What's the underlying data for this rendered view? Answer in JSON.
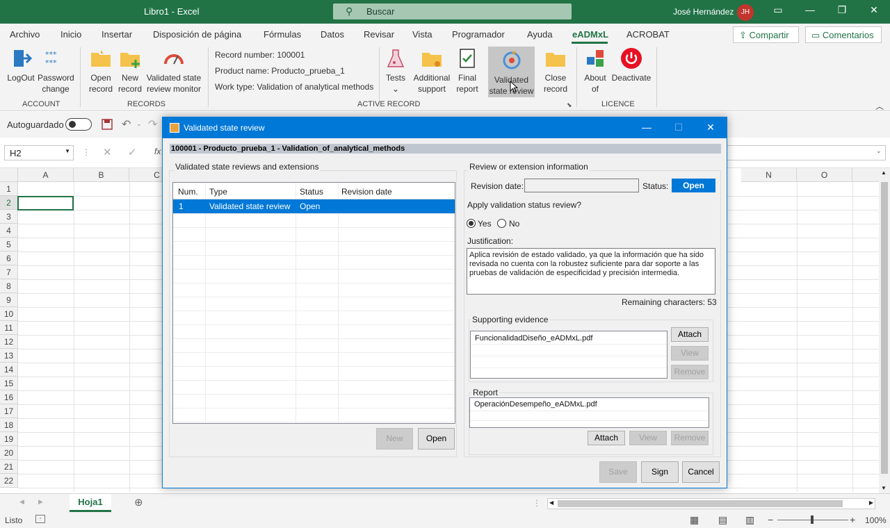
{
  "titlebar": {
    "doc_title": "Libro1  -  Excel",
    "search_placeholder": "Buscar",
    "user_name": "José Hernández",
    "user_initials": "JH"
  },
  "menu": {
    "items": [
      "Archivo",
      "Inicio",
      "Insertar",
      "Disposición de página",
      "Fórmulas",
      "Datos",
      "Revisar",
      "Vista",
      "Programador",
      "Ayuda",
      "eADMxL",
      "ACROBAT"
    ],
    "active": "eADMxL",
    "share": "Compartir",
    "comments": "Comentarios"
  },
  "ribbon": {
    "logout": "LogOut",
    "password1": "Password",
    "password2": "change",
    "open1": "Open",
    "open2": "record",
    "new1": "New",
    "new2": "record",
    "monitor1": "Validated state",
    "monitor2": "review monitor",
    "record_number": "Record number: 100001",
    "product_name": "Product name: Producto_prueba_1",
    "work_type": "Work type: Validation of analytical methods",
    "tests": "Tests",
    "additional1": "Additional",
    "additional2": "support",
    "final1": "Final",
    "final2": "report",
    "validated1": "Validated",
    "validated2": "state review",
    "close1": "Close",
    "close2": "record",
    "about1": "About",
    "about2": "of",
    "deactivate": "Deactivate",
    "groups": {
      "account": "ACCOUNT",
      "records": "RECORDS",
      "active_record": "ACTIVE RECORD",
      "licence": "LICENCE"
    }
  },
  "quick": {
    "autosave": "Autoguardado"
  },
  "formula": {
    "namebox": "H2",
    "fx": "fx"
  },
  "grid": {
    "columns": [
      "A",
      "B",
      "C",
      "N",
      "O"
    ],
    "rows": [
      "1",
      "2",
      "3",
      "4",
      "5",
      "6",
      "7",
      "8",
      "9",
      "10",
      "11",
      "12",
      "13",
      "14",
      "15",
      "16",
      "17",
      "18",
      "19",
      "20",
      "21",
      "22"
    ]
  },
  "sheet": {
    "tab": "Hoja1"
  },
  "status": {
    "ready": "Listo",
    "zoom": "100%"
  },
  "dialog": {
    "title": "Validated state review",
    "record_bar": "100001 - Producto_prueba_1 - Validation_of_analytical_methods",
    "left_group": "Validated state reviews and extensions",
    "table": {
      "headers": [
        "Num.",
        "Type",
        "Status",
        "Revision date"
      ],
      "rows": [
        {
          "num": "1",
          "type": "Validated state review",
          "status": "Open",
          "date": ""
        }
      ]
    },
    "new_btn": "New",
    "open_btn": "Open",
    "right_group": "Review or extension information",
    "revision_date_label": "Revision date:",
    "revision_date_value": "",
    "status_label": "Status:",
    "status_value": "Open",
    "apply_question": "Apply validation status review?",
    "yes": "Yes",
    "no": "No",
    "justification_label": "Justification:",
    "justification_text": "Aplica revisión de estado validado, ya que  la información que ha sido revisada no cuenta con la robustez suficiente para dar soporte a las pruebas de validación de especificidad y precisión intermedia.",
    "remaining": "Remaining characters: 53",
    "evidence_group": "Supporting evidence",
    "evidence_file": "FuncionalidadDiseño_eADMxL.pdf",
    "attach": "Attach",
    "view": "View",
    "remove": "Remove",
    "report_group": "Report",
    "report_file": "OperaciónDesempeño_eADMxL.pdf",
    "save": "Save",
    "sign": "Sign",
    "cancel": "Cancel"
  },
  "colors": {
    "excel_green": "#217346",
    "dialog_blue": "#0078d7",
    "deactivate_red": "#e81123"
  }
}
